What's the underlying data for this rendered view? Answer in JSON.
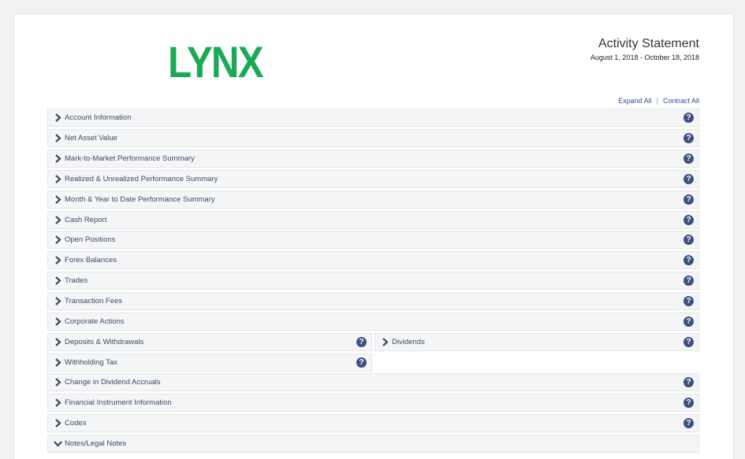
{
  "header": {
    "logo_text": "LYNX",
    "title": "Activity Statement",
    "period": "August 1, 2018 - October 18, 2018"
  },
  "actions": {
    "expand_all": "Expand All",
    "separator": "|",
    "contract_all": "Contract All"
  },
  "help_glyph": "?",
  "sections": [
    {
      "id": "account-information",
      "label": "Account Information",
      "state": "collapsed"
    },
    {
      "id": "net-asset-value",
      "label": "Net Asset Value",
      "state": "collapsed"
    },
    {
      "id": "mtm-performance-summary",
      "label": "Mark-to-Market Performance Summary",
      "state": "collapsed"
    },
    {
      "id": "realized-unrealized-summary",
      "label": "Realized & Unrealized Performance Summary",
      "state": "collapsed"
    },
    {
      "id": "month-year-summary",
      "label": "Month & Year to Date Performance Summary",
      "state": "collapsed"
    },
    {
      "id": "cash-report",
      "label": "Cash Report",
      "state": "collapsed"
    },
    {
      "id": "open-positions",
      "label": "Open Positions",
      "state": "collapsed"
    },
    {
      "id": "forex-balances",
      "label": "Forex Balances",
      "state": "collapsed"
    },
    {
      "id": "trades",
      "label": "Trades",
      "state": "collapsed"
    },
    {
      "id": "transaction-fees",
      "label": "Transaction Fees",
      "state": "collapsed"
    },
    {
      "id": "corporate-actions",
      "label": "Corporate Actions",
      "state": "collapsed"
    },
    {
      "id": "deposits-withdrawals",
      "label": "Deposits & Withdrawals",
      "state": "collapsed"
    },
    {
      "id": "dividends",
      "label": "Dividends",
      "state": "collapsed"
    },
    {
      "id": "withholding-tax",
      "label": "Withholding Tax",
      "state": "collapsed"
    },
    {
      "id": "change-dividend-accruals",
      "label": "Change in Dividend Accruals",
      "state": "collapsed"
    },
    {
      "id": "financial-instrument-info",
      "label": "Financial Instrument Information",
      "state": "collapsed"
    },
    {
      "id": "codes",
      "label": "Codes",
      "state": "collapsed"
    },
    {
      "id": "notes-legal",
      "label": "Notes/Legal Notes",
      "state": "expanded"
    }
  ]
}
